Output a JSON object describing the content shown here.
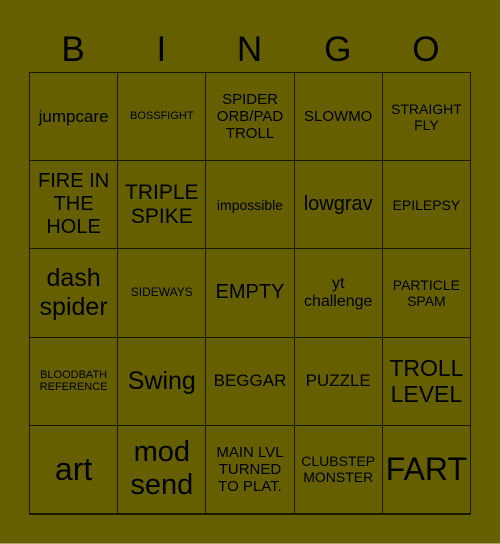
{
  "header": {
    "letters": [
      "B",
      "I",
      "N",
      "G",
      "O"
    ]
  },
  "board": {
    "rows": [
      [
        "jumpcare",
        "BOSSFIGHT",
        "SPIDER ORB/PAD TROLL",
        "SLOWMO",
        "STRAIGHT FLY"
      ],
      [
        "FIRE IN THE HOLE",
        "TRIPLE SPIKE",
        "impossible",
        "lowgrav",
        "EPILEPSY"
      ],
      [
        "dash spider",
        "SIDEWAYS",
        "EMPTY",
        "yt challenge",
        "PARTICLE SPAM"
      ],
      [
        "BLOODBATH REFERENCE",
        "Swing",
        "BEGGAR",
        "PUZZLE",
        "TROLL LEVEL"
      ],
      [
        "art",
        "mod send",
        "MAIN LVL TURNED TO PLAT.",
        "CLUBSTEP MONSTER",
        "FART"
      ]
    ]
  },
  "colors": {
    "background": "#665f00",
    "grid_line": "#1a1800",
    "text": "#000000"
  }
}
